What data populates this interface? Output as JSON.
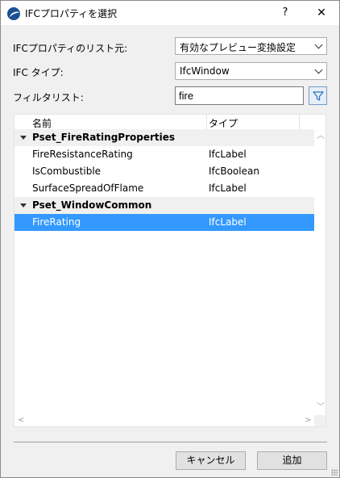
{
  "window": {
    "title": "IFCプロパティを選択",
    "help_symbol": "?",
    "close_symbol": "✕",
    "icon": "archicad-app-icon"
  },
  "form": {
    "source_label": "IFCプロパティのリスト元:",
    "source_value": "有効なプレビュー変換設定",
    "ifc_type_label": "IFC タイプ:",
    "ifc_type_value": "IfcWindow",
    "filter_label": "フィルタリスト:",
    "filter_value": "fire"
  },
  "tree": {
    "columns": [
      "名前",
      "タイプ"
    ],
    "groups": [
      {
        "name": "Pset_FireRatingProperties",
        "items": [
          {
            "name": "FireResistanceRating",
            "type": "IfcLabel"
          },
          {
            "name": "IsCombustible",
            "type": "IfcBoolean"
          },
          {
            "name": "SurfaceSpreadOfFlame",
            "type": "IfcLabel"
          }
        ]
      },
      {
        "name": "Pset_WindowCommon",
        "items": [
          {
            "name": "FireRating",
            "type": "IfcLabel",
            "selected": true
          }
        ]
      }
    ]
  },
  "buttons": {
    "cancel": "キャンセル",
    "add": "追加"
  },
  "colors": {
    "selection": "#3399ff",
    "dialog_bg": "#f0f0f0",
    "filter_button": "#e6eef7"
  }
}
